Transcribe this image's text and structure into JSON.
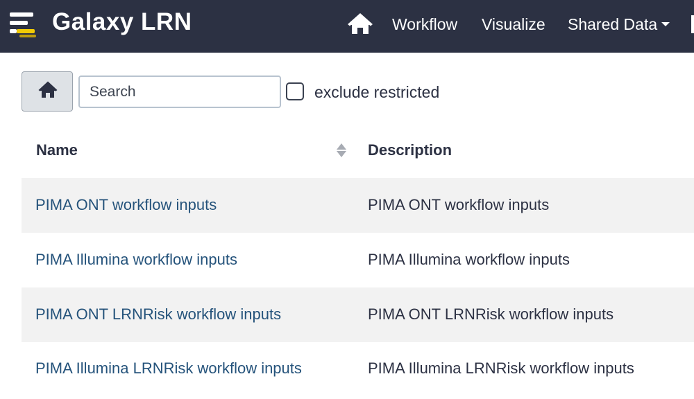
{
  "navbar": {
    "brand": "Galaxy LRN",
    "home_icon": "home-icon",
    "logo_icon": "galaxy-logo-icon",
    "links": [
      "Workflow",
      "Visualize",
      "Shared Data"
    ],
    "background": "#2c3143"
  },
  "toolbar": {
    "home_icon": "home-icon",
    "search_placeholder": "Search",
    "search_value": "",
    "exclude_label": "exclude restricted",
    "exclude_checked": false
  },
  "table": {
    "columns": [
      "Name",
      "Description"
    ],
    "sort_icon": "sort-icon",
    "link_color": "#25537b",
    "rows": [
      {
        "name": "PIMA ONT workflow inputs",
        "description": "PIMA ONT workflow inputs"
      },
      {
        "name": "PIMA Illumina workflow inputs",
        "description": "PIMA Illumina workflow inputs"
      },
      {
        "name": "PIMA ONT LRNRisk workflow inputs",
        "description": "PIMA ONT LRNRisk workflow inputs"
      },
      {
        "name": "PIMA Illumina LRNRisk workflow inputs",
        "description": "PIMA Illumina LRNRisk workflow inputs"
      }
    ]
  }
}
